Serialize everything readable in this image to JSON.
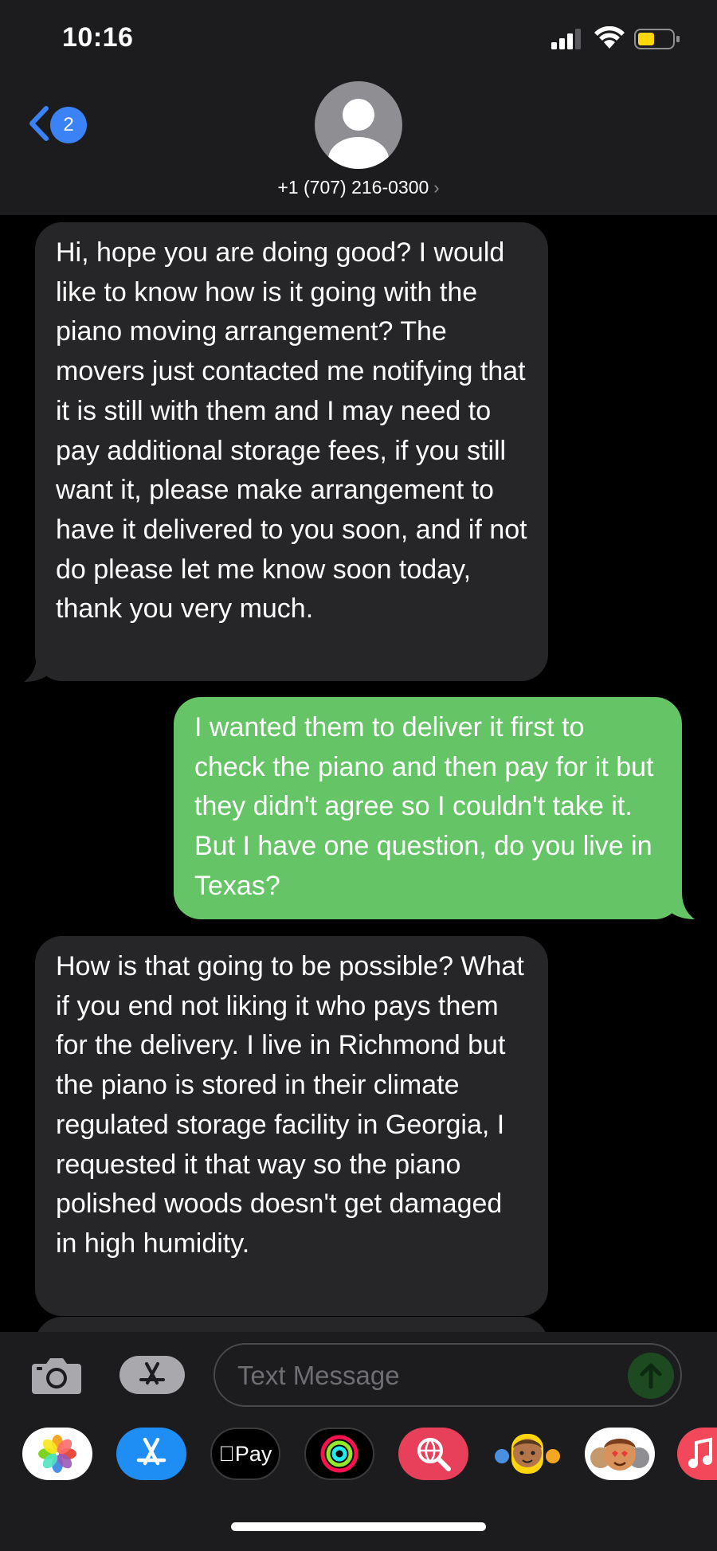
{
  "status_bar": {
    "time": "10:16"
  },
  "header": {
    "back_badge_count": "2",
    "contact_name": "+1 (707) 216-0300"
  },
  "messages": [
    {
      "direction": "incoming",
      "text": "Hi, hope you are doing good? I would like to know how is it going with the piano moving arrangement? The movers just contacted me notifying that it is still with them and I may need to pay additional storage fees, if you still want it, please make arrangement to have it delivered to you soon, and if not do please let me know soon today, thank you very much."
    },
    {
      "direction": "outgoing",
      "text": "I wanted them to deliver it first to check the piano and then pay for it but they didn't agree so I couldn't take it.  But I have one question, do you live in Texas?"
    },
    {
      "direction": "incoming",
      "text": "How is that going to be possible? What if you end not liking it who pays them for the delivery. I live in Richmond but the piano is stored in their climate regulated storage facility in Georgia, I requested it that way so the piano polished woods doesn't get damaged in high humidity."
    }
  ],
  "input": {
    "placeholder": "Text Message"
  },
  "app_drawer": {
    "apple_pay_label": "Pay",
    "apps": [
      "photos-app",
      "app-store-app",
      "apple-pay-app",
      "activity-app",
      "image-search-app",
      "memoji-app",
      "animoji-app",
      "music-app"
    ]
  },
  "colors": {
    "incoming_bubble": "#262628",
    "outgoing_bubble": "#65c466",
    "accent": "#3a82f6"
  }
}
